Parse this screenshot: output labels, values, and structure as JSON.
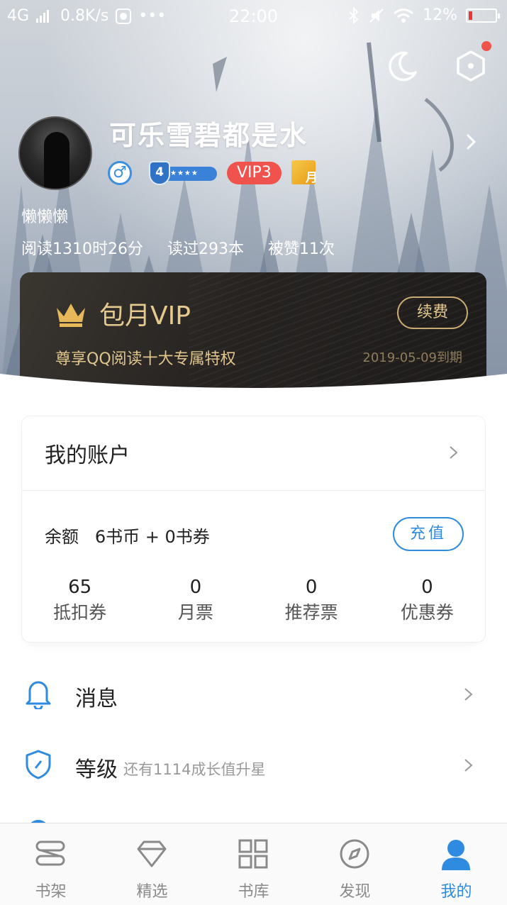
{
  "status_bar": {
    "network": "4G",
    "speed": "0.8K/s",
    "more": "•••",
    "time": "22:00",
    "battery": "12%"
  },
  "profile": {
    "username": "可乐雪碧都是水",
    "level_badge_number": "4",
    "level_badge_stars": "★★★★",
    "vip_badge": "VIP3",
    "month_badge": "月",
    "gender_symbol": "♂",
    "signature": "懒懒懒",
    "stats": [
      "阅读1310时26分",
      "读过293本",
      "被赞11次"
    ]
  },
  "vip_card": {
    "title": "包月VIP",
    "description": "尊享QQ阅读十大专属特权",
    "expiry": "2019-05-09到期",
    "renew_label": "续费",
    "accent_color": "#e6c98e"
  },
  "account": {
    "title": "我的账户",
    "balance_text": "余额   6书币 + 0书券",
    "recharge_label": "充值",
    "tickets": [
      {
        "value": "65",
        "label": "抵扣券"
      },
      {
        "value": "0",
        "label": "月票"
      },
      {
        "value": "0",
        "label": "推荐票"
      },
      {
        "value": "0",
        "label": "优惠券"
      }
    ]
  },
  "menu": [
    {
      "label": "消息",
      "sub": "",
      "icon": "bell-icon"
    },
    {
      "label": "等级",
      "sub": "还有1114成长值升星",
      "icon": "shield-icon"
    }
  ],
  "tabbar": {
    "active_color": "#2f8be0",
    "tabs": [
      {
        "label": "书架",
        "icon": "bookshelf-icon"
      },
      {
        "label": "精选",
        "icon": "diamond-icon"
      },
      {
        "label": "书库",
        "icon": "grid-icon"
      },
      {
        "label": "发现",
        "icon": "compass-icon"
      },
      {
        "label": "我的",
        "icon": "person-icon",
        "active": true
      }
    ]
  }
}
